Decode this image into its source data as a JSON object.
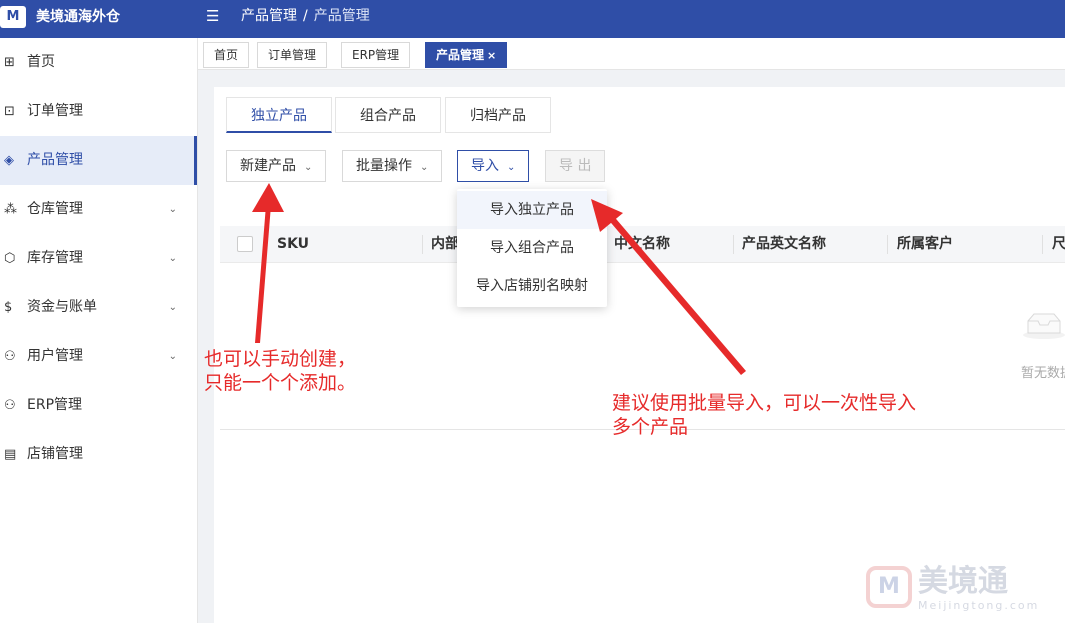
{
  "app": {
    "logo_text": "M",
    "title": "美境通海外仓"
  },
  "breadcrumb": {
    "parent": "产品管理",
    "separator": "/",
    "current": "产品管理"
  },
  "sidebar": {
    "items": [
      {
        "label": "首页",
        "icon": "grid-icon",
        "glyph": "⊞"
      },
      {
        "label": "订单管理",
        "icon": "order-icon",
        "glyph": "⊡"
      },
      {
        "label": "产品管理",
        "icon": "product-icon",
        "glyph": "◈"
      },
      {
        "label": "仓库管理",
        "icon": "warehouse-icon",
        "glyph": "⁂"
      },
      {
        "label": "库存管理",
        "icon": "box-icon",
        "glyph": "⬡"
      },
      {
        "label": "资金与账单",
        "icon": "dollar-icon",
        "glyph": "$"
      },
      {
        "label": "用户管理",
        "icon": "user-icon",
        "glyph": "⚇"
      },
      {
        "label": "ERP管理",
        "icon": "user-icon",
        "glyph": "⚇"
      },
      {
        "label": "店铺管理",
        "icon": "store-icon",
        "glyph": "▤"
      }
    ]
  },
  "tags": {
    "items": [
      "首页",
      "订单管理",
      "ERP管理",
      "产品管理"
    ],
    "close_glyph": "×"
  },
  "sub_tabs": [
    "独立产品",
    "组合产品",
    "归档产品"
  ],
  "toolbar": {
    "new_product": "新建产品",
    "batch_ops": "批量操作",
    "import": "导入",
    "export": "导 出"
  },
  "import_menu": [
    "导入独立产品",
    "导入组合产品",
    "导入店铺别名映射"
  ],
  "table": {
    "columns": [
      "SKU",
      "内部",
      "中文名称",
      "产品英文名称",
      "所属客户",
      "尺"
    ]
  },
  "empty_text": "暂无数据",
  "annotations": {
    "left": [
      "也可以手动创建，",
      "只能一个个添加。"
    ],
    "right": [
      "建议使用批量导入，可以一次性导入",
      "多个产品"
    ]
  },
  "watermark": {
    "cn": "美境通",
    "en": "Meijingtong.com"
  },
  "colors": {
    "primary": "#2f4ea7",
    "annotation": "#e62a2a"
  }
}
